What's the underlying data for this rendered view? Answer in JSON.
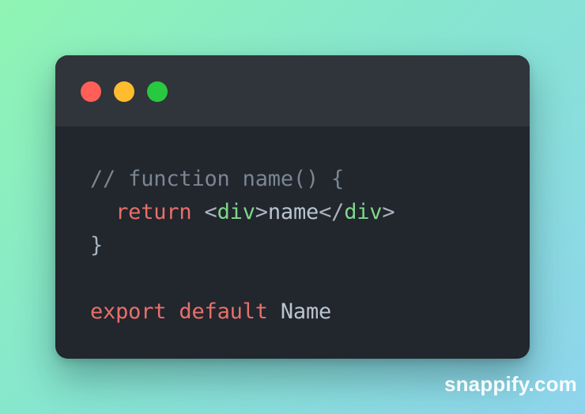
{
  "window": {
    "controls": [
      {
        "name": "close",
        "color": "#ff5f57"
      },
      {
        "name": "minimize",
        "color": "#febc2e"
      },
      {
        "name": "maximize",
        "color": "#28c840"
      }
    ]
  },
  "code": {
    "lines": [
      [
        {
          "text": "// function name() {",
          "kind": "comment"
        }
      ],
      [
        {
          "text": "  ",
          "kind": "plain"
        },
        {
          "text": "return",
          "kind": "keyword"
        },
        {
          "text": " <",
          "kind": "punct"
        },
        {
          "text": "div",
          "kind": "tag"
        },
        {
          "text": ">",
          "kind": "punct"
        },
        {
          "text": "name",
          "kind": "plain"
        },
        {
          "text": "</",
          "kind": "punct"
        },
        {
          "text": "div",
          "kind": "tag"
        },
        {
          "text": ">",
          "kind": "punct"
        }
      ],
      [
        {
          "text": "}",
          "kind": "punct"
        }
      ],
      [],
      [
        {
          "text": "export",
          "kind": "keyword"
        },
        {
          "text": " ",
          "kind": "plain"
        },
        {
          "text": "default",
          "kind": "keyword"
        },
        {
          "text": " Name",
          "kind": "plain"
        }
      ]
    ]
  },
  "colors": {
    "comment": "#7a8693",
    "keyword": "#e8706a",
    "tag": "#7fd78a",
    "punct": "#aab4c0",
    "plain": "#b9c5d1",
    "window_background": "#22262d",
    "titlebar_background": "#30343b"
  },
  "watermark": {
    "text": "snappify.com"
  }
}
